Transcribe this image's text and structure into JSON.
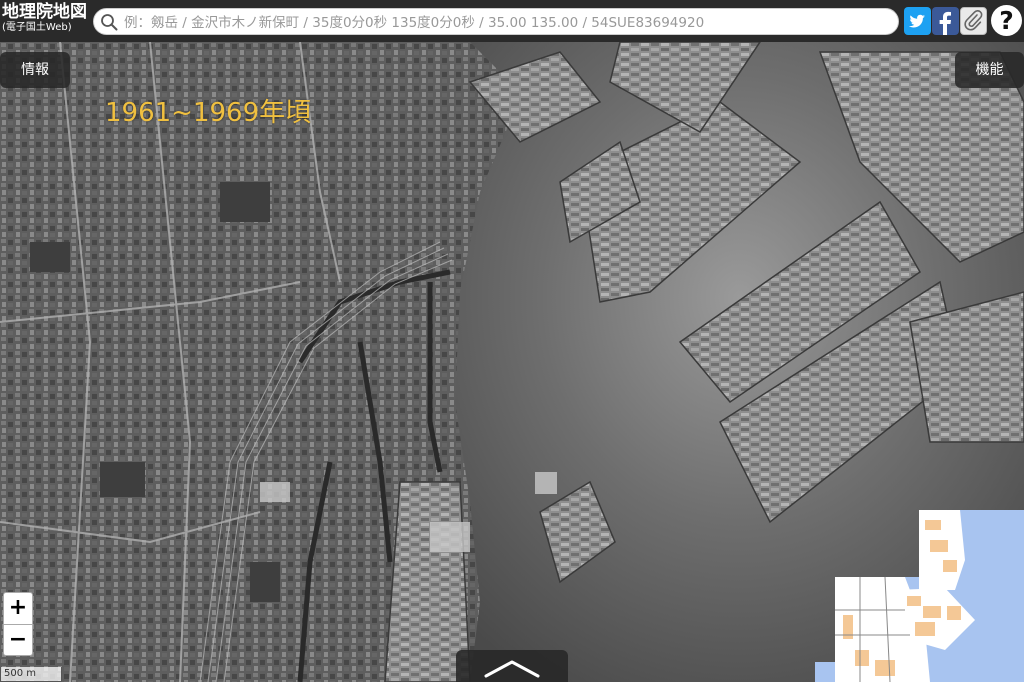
{
  "header": {
    "logo_main": "地理院地図",
    "logo_sub": "(電子国土Web)",
    "search_placeholder": "例：剱岳 / 金沢市木ノ新保町 / 35度0分0秒 135度0分0秒 / 35.00 135.00 / 54SUE83694920",
    "search_value": "",
    "help_label": "?"
  },
  "icons": {
    "twitter": "twitter-icon",
    "facebook": "facebook-icon",
    "clip": "paperclip-icon",
    "search": "search-icon",
    "drawer": "chevron-up-icon"
  },
  "map": {
    "era_label": "1961~1969年頃",
    "info_button": "情報",
    "function_button": "機能",
    "zoom_in": "+",
    "zoom_out": "−",
    "scale_label": "500 m",
    "layer": "aerial-photo-grayscale"
  },
  "colors": {
    "header_bg": "#2a2a2a",
    "era_label": "#f0c040",
    "twitter": "#1da1f2",
    "facebook": "#3b5998",
    "minimap_water": "#a8c4f0",
    "minimap_building": "#f4c896",
    "minimap_land": "#ffffff"
  }
}
